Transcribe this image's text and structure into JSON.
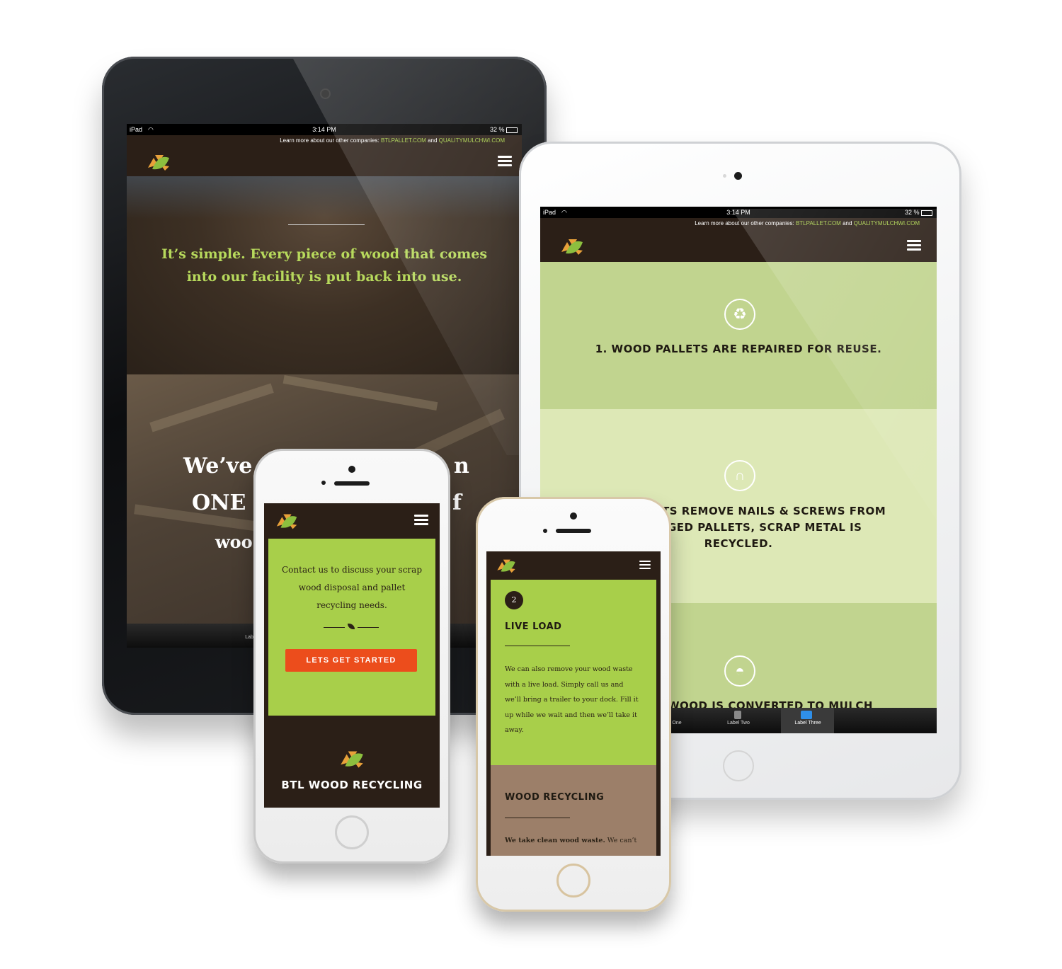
{
  "ipad_black": {
    "status": {
      "device": "iPad",
      "time": "3:14 PM",
      "battery": "32 %"
    },
    "topbar": {
      "text": "Learn more about our other companies:",
      "link1": "BTLPALLET.COM",
      "and": "and",
      "link2": "QUALITYMULCHWI.COM"
    },
    "hero_line1": "It’s simple. Every piece of wood that comes",
    "hero_line2": "into our facility is put back into use.",
    "big_line1_a": "We’ve",
    "big_line1_b": "n",
    "big_line2_a": "ONE F",
    "big_line2_b": "f",
    "big_line3": "woo",
    "tab_partial": "Labe"
  },
  "ipad_white": {
    "status": {
      "device": "iPad",
      "time": "3:14 PM",
      "battery": "32 %"
    },
    "topbar": {
      "text": "Learn more about our other companies:",
      "link1": "BTLPALLET.COM",
      "and": "and",
      "link2": "QUALITYMULCHWI.COM"
    },
    "step1": "1. WOOD PALLETS ARE REPAIRED FOR REUSE.",
    "step2_line1": "TS REMOVE NAILS & SCREWS FROM",
    "step2_line2": "GED PALLETS, SCRAP METAL IS",
    "step2_line3": "RECYCLED.",
    "step3_partial": "WOOD IS CONVERTED TO MULCH",
    "tabs": [
      "One",
      "Label Two",
      "Label Three"
    ]
  },
  "iphone_silver": {
    "contact_line1": "Contact us to discuss your scrap",
    "contact_line2": "wood disposal and pallet",
    "contact_line3": "recycling needs.",
    "cta": "LETS GET STARTED",
    "brand": "BTL WOOD RECYCLING"
  },
  "iphone_gold": {
    "step_number": "2",
    "live_load_title": "LIVE LOAD",
    "live_load_lines": [
      "We can also remove your wood waste",
      "with a live load. Simply call us and",
      "we’ll bring a trailer to your dock. Fill it",
      "up while we wait and then we’ll take it",
      "away."
    ],
    "wood_title": "WOOD RECYCLING",
    "wood_bold": "We take clean wood waste.",
    "wood_rest": " We can’t"
  },
  "colors": {
    "brown": "#2b1f17",
    "lime": "#a8cf4a",
    "light_green": "#dde8b6",
    "mid_green": "#c1d48f",
    "orange": "#ec4d1c",
    "tan": "#9c7f69"
  }
}
